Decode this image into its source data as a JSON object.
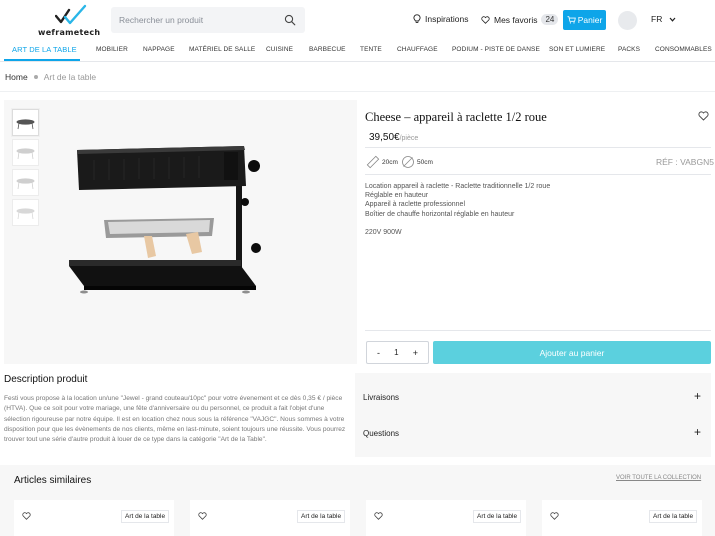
{
  "header": {
    "logo_text": "weframetech",
    "search_placeholder": "Rechercher un produit",
    "inspirations_label": "Inspirations",
    "favorites_label": "Mes favoris",
    "favorites_count": "24",
    "cart_label": "Panier",
    "language": "FR"
  },
  "nav": {
    "categories": [
      "ART DE LA TABLE",
      "MOBILIER",
      "NAPPAGE",
      "MATÉRIEL DE SALLE",
      "CUISINE",
      "BARBECUE",
      "TENTE",
      "CHAUFFAGE",
      "PODIUM - PISTE DE DANSE",
      "SON ET LUMIERE",
      "PACKS",
      "CONSOMMABLES"
    ]
  },
  "breadcrumb": {
    "home": "Home",
    "current": "Art de la table"
  },
  "product": {
    "title": "Cheese – appareil à raclette 1/2 roue",
    "price": "39,50€",
    "price_unit": "/pièce",
    "dimension_1": "20cm",
    "dimension_2": "50cm",
    "reference": "RÉF : VABGN5",
    "description_lines": [
      "Location appareil à raclette - Raclette traditionnelle 1/2 roue",
      "Réglable en hauteur",
      "Appareil à raclette professionnel",
      "Boîtier de chauffe horizontal réglable en hauteur"
    ],
    "power": "220V 900W",
    "quantity_minus": "-",
    "quantity": "1",
    "quantity_plus": "+",
    "add_to_cart": "Ajouter au panier"
  },
  "description": {
    "title": "Description produit",
    "body": "Festi vous propose à la location un/une \"Jewel - grand couteau/10pc\" pour votre évenement et ce dès 0,35 € / pièce (HTVA). Que ce soit pour votre mariage, une fête d'anniversaire ou du personnel, ce produit a fait l'objet d'une sélection rigoureuse par notre équipe. Il est en location chez nous sous la référence \"VAJGC\". Nous sommes à votre disposition pour que les évènements de nos clients, même en last-minute, soient toujours une réussite. Vous pourrez trouver tout une série d'autre produit à louer de ce type dans la catégorie \"Art de la Table\"."
  },
  "accordion": {
    "items": [
      "Livraisons",
      "Questions"
    ],
    "expand_symbol": "+"
  },
  "similar": {
    "title": "Articles similaires",
    "view_all": "VOIR TOUTE LA COLLECTION",
    "cards": [
      {
        "tag": "Art de la table"
      },
      {
        "tag": "Art de la table"
      },
      {
        "tag": "Art de la table"
      },
      {
        "tag": "Art de la table"
      }
    ]
  },
  "colors": {
    "accent": "#0ea5e9",
    "add_button": "#5bd0de",
    "panel_bg": "#f7f7f7"
  },
  "icons": [
    "search-icon",
    "lightbulb-icon",
    "heart-icon",
    "cart-icon",
    "chevron-down-icon",
    "ruler-icon",
    "diameter-icon",
    "plus-icon"
  ]
}
